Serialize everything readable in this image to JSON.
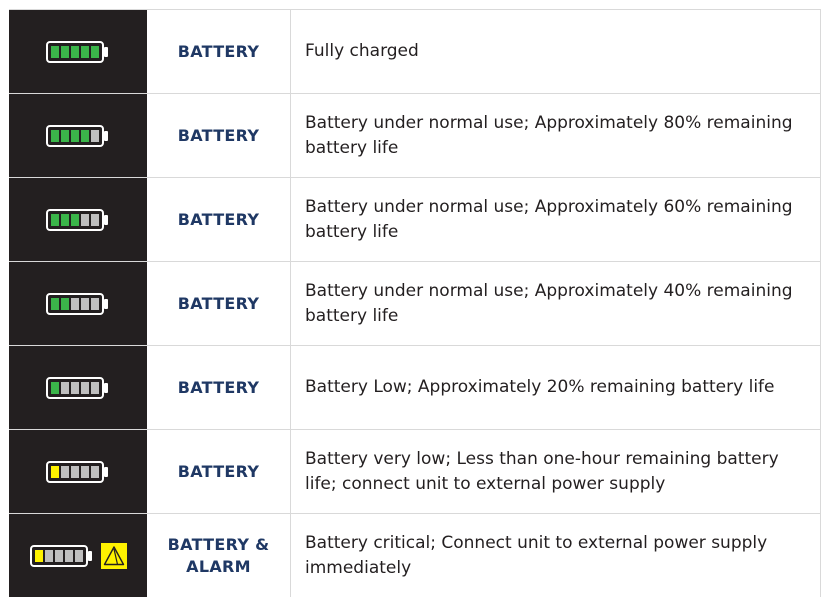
{
  "colors": {
    "cell_dark": "#231f20",
    "label": "#1f3864",
    "seg_green": "#3bb54a",
    "seg_empty": "#bfbfbf",
    "seg_yellow": "#fff200",
    "alarm": "#fff200"
  },
  "rows": [
    {
      "label": "BATTERY",
      "description": "Fully charged",
      "level": 5,
      "segment_color": "green"
    },
    {
      "label": "BATTERY",
      "description": "Battery under normal use; Approximately 80% remaining battery life",
      "level": 4,
      "segment_color": "green"
    },
    {
      "label": "BATTERY",
      "description": "Battery under normal use; Approximately 60% remaining battery life",
      "level": 3,
      "segment_color": "green"
    },
    {
      "label": "BATTERY",
      "description": "Battery under normal use; Approximately 40% remaining battery life",
      "level": 2,
      "segment_color": "green"
    },
    {
      "label": "BATTERY",
      "description": "Battery Low; Approximately 20% remaining battery life",
      "level": 1,
      "segment_color": "green"
    },
    {
      "label": "BATTERY",
      "description": "Battery very low; Less than one-hour remaining battery life; connect unit to external power supply",
      "level": 1,
      "segment_color": "yellow"
    },
    {
      "label": "BATTERY & ALARM",
      "description": "Battery critical; Connect unit to external power supply immediately",
      "level": 1,
      "segment_color": "yellow",
      "alarm_icon": "warning-triangle-icon"
    }
  ]
}
